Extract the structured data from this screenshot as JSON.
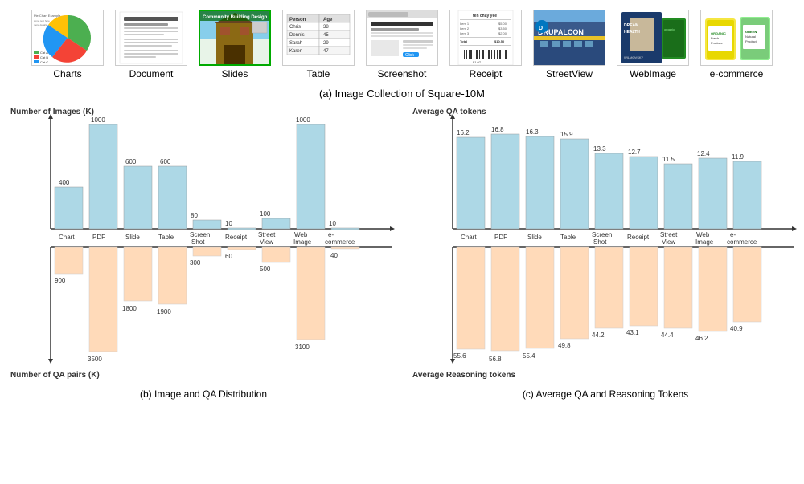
{
  "title": "(a) Image Collection of Square-10M",
  "subtitle_b": "(b) Image and QA Distribution",
  "subtitle_c": "(c) Average QA and Reasoning Tokens",
  "categories": [
    "Charts",
    "Document",
    "Slides",
    "Table",
    "Screenshot",
    "Receipt",
    "StreetView",
    "WebImage",
    "e-commerce"
  ],
  "category_short": [
    "Chart",
    "PDF",
    "Slide",
    "Table",
    "Screen\nShot",
    "Receipt",
    "Street\nView",
    "Web\nImage",
    "e-\ncommerce"
  ],
  "slides_selected": true,
  "chart_b": {
    "top_title": "Number of Images (K)",
    "bottom_title": "Number of QA pairs (K)",
    "top_values": [
      400,
      1000,
      600,
      600,
      80,
      10,
      100,
      1000,
      10
    ],
    "bottom_values": [
      900,
      3500,
      1800,
      1900,
      300,
      60,
      500,
      3100,
      40
    ]
  },
  "chart_c": {
    "top_title": "Average QA tokens",
    "bottom_title": "Average Reasoning tokens",
    "top_values": [
      16.2,
      16.8,
      16.3,
      15.9,
      13.3,
      12.7,
      11.5,
      12.4,
      11.9
    ],
    "bottom_values": [
      55.6,
      56.8,
      55.4,
      49.8,
      44.2,
      43.1,
      44.4,
      46.2,
      40.9
    ]
  }
}
